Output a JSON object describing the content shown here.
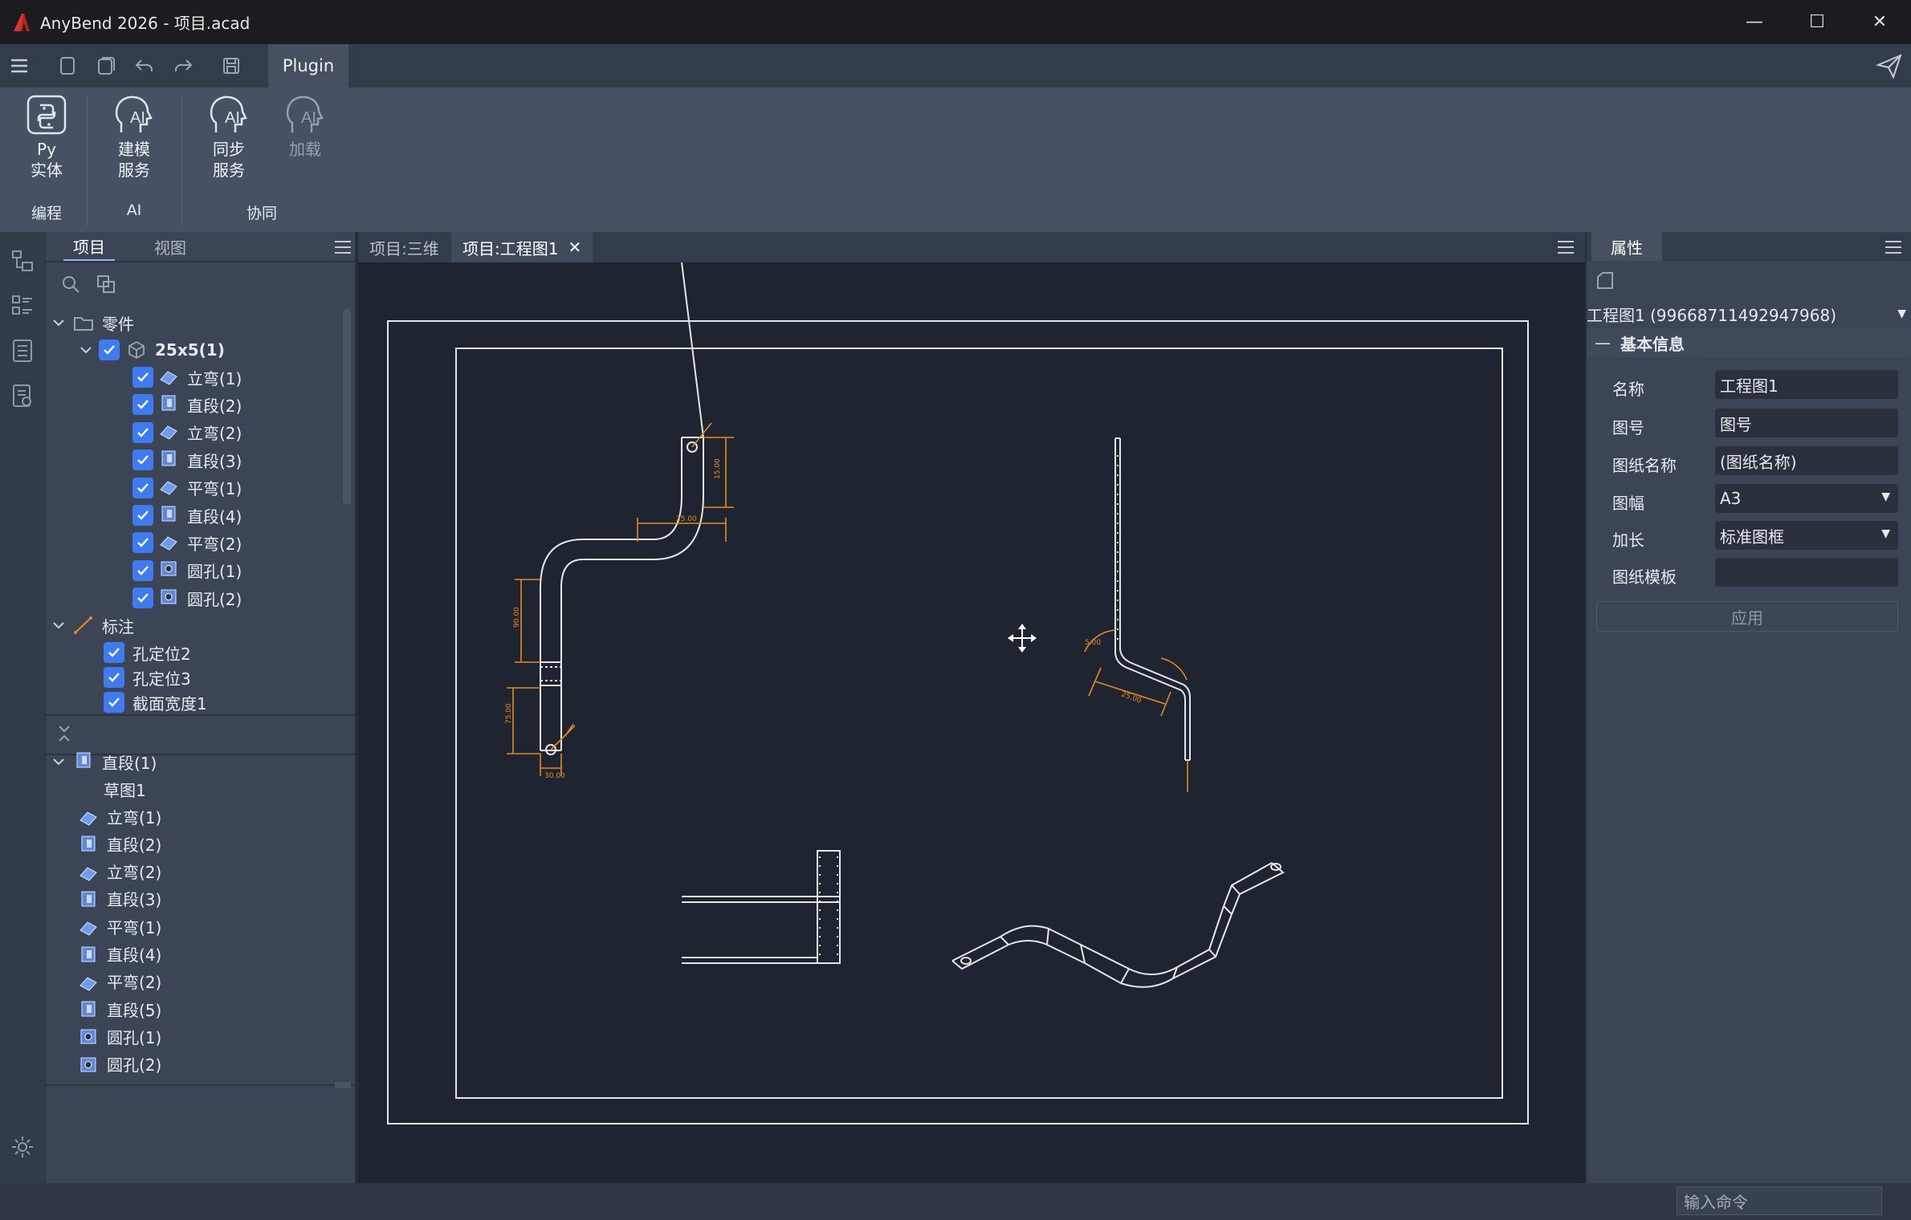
{
  "window": {
    "title": "AnyBend 2026 - 项目.acad",
    "minimize": "—",
    "maximize": "☐",
    "close": "✕"
  },
  "menu": {
    "active_tab": "Plugin"
  },
  "ribbon": {
    "buttons": [
      {
        "label": "Py\n实体",
        "icon": "python-icon"
      },
      {
        "label": "建模\n服务",
        "icon": "ai-head-icon"
      },
      {
        "label": "同步\n服务",
        "icon": "ai-head-icon"
      },
      {
        "label": "加载",
        "icon": "ai-head-icon",
        "disabled": true
      }
    ],
    "groups": [
      "编程",
      "AI",
      "协同"
    ]
  },
  "project_panel": {
    "tabs": [
      "项目",
      "视图"
    ],
    "tree": {
      "parts_folder": "零件",
      "part": "25x5(1)",
      "features": [
        "立弯(1)",
        "直段(2)",
        "立弯(2)",
        "直段(3)",
        "平弯(1)",
        "直段(4)",
        "平弯(2)",
        "圆孔(1)",
        "圆孔(2)"
      ],
      "annotation_folder": "标注",
      "annotations": [
        "孔定位2",
        "孔定位3",
        "截面宽度1"
      ]
    },
    "history": {
      "root": "直段(1)",
      "sketch": "草图1",
      "items": [
        "立弯(1)",
        "直段(2)",
        "立弯(2)",
        "直段(3)",
        "平弯(1)",
        "直段(4)",
        "平弯(2)",
        "直段(5)",
        "圆孔(1)",
        "圆孔(2)"
      ]
    }
  },
  "doc_tabs": [
    "项目:三维",
    "项目:工程图1"
  ],
  "properties": {
    "tab": "属性",
    "object": "工程图1 (99668711492947968)",
    "section": "基本信息",
    "rows": [
      {
        "label": "名称",
        "value": "工程图1"
      },
      {
        "label": "图号",
        "value": "图号"
      },
      {
        "label": "图纸名称",
        "value": "(图纸名称)"
      },
      {
        "label": "图幅",
        "value": "A3"
      },
      {
        "label": "加长",
        "value": "标准图框"
      },
      {
        "label": "图纸模板",
        "value": ""
      }
    ],
    "apply": "应用"
  },
  "drawing": {
    "dim_labels": [
      "25.00",
      "75.00",
      "90.00",
      "15.00",
      "30.00",
      "5.00"
    ]
  },
  "status": {
    "command_placeholder": "输入命令"
  },
  "colors": {
    "accent": "#3e7bf0",
    "dimension": "#e8891d",
    "canvas": "#1f2530"
  }
}
